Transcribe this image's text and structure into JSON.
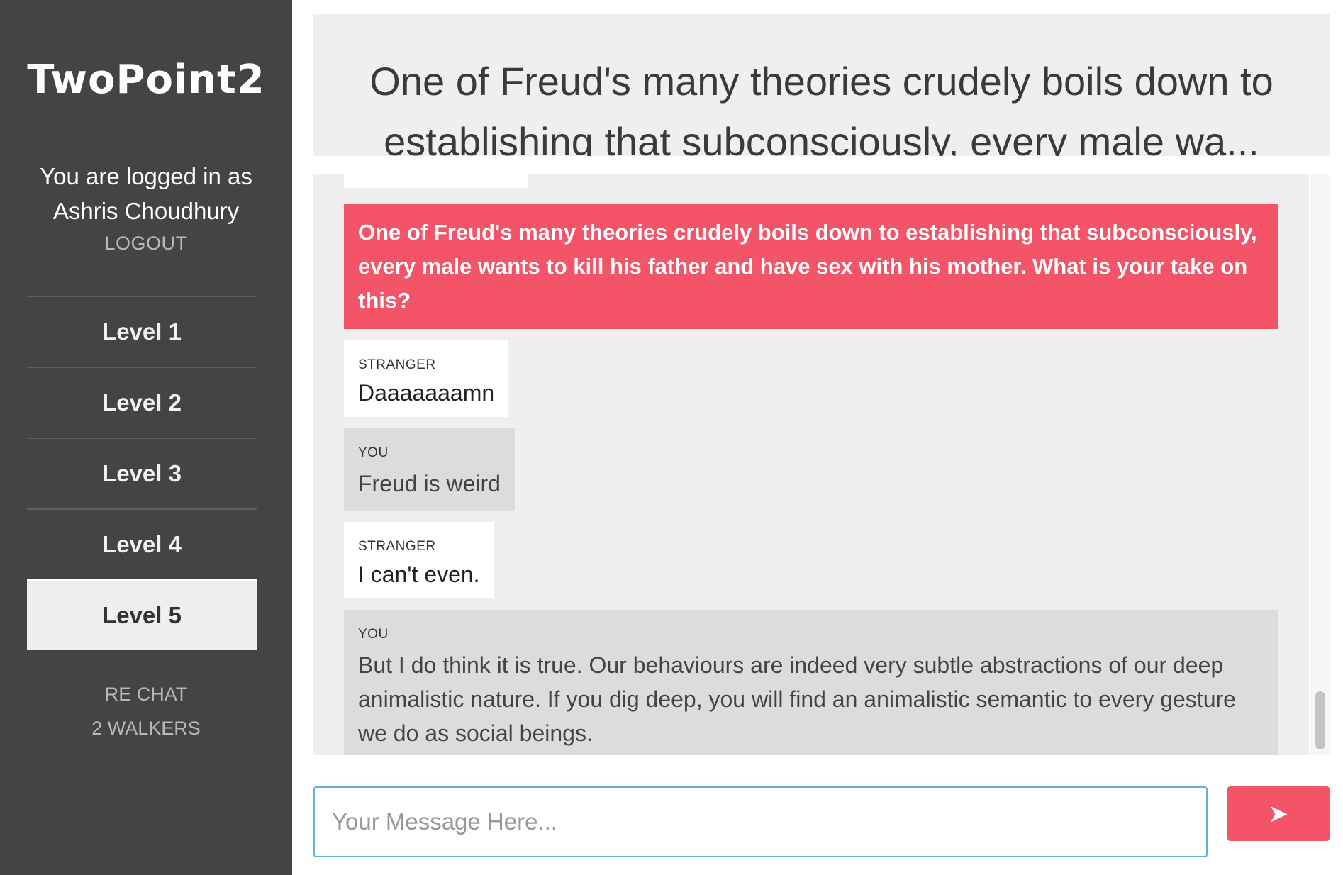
{
  "sidebar": {
    "app_title": "TwoPoint2",
    "logged_in_prefix": "You are logged in as",
    "user_name": "Ashris Choudhury",
    "logout_label": "LOGOUT",
    "levels": [
      {
        "label": "Level 1",
        "active": false
      },
      {
        "label": "Level 2",
        "active": false
      },
      {
        "label": "Level 3",
        "active": false
      },
      {
        "label": "Level 4",
        "active": false
      },
      {
        "label": "Level 5",
        "active": true
      }
    ],
    "rechat_label": "RE CHAT",
    "walkers_label": "2 WALKERS"
  },
  "topic": {
    "line1": "One of Freud's many theories crudely boils down to",
    "line2": "establishing that subconsciously, every male wa..."
  },
  "chat": {
    "topic_message": "One of Freud's many theories crudely boils down to establishing that subconsciously, every male wants to kill his father and have sex with his mother. What is your take on this?",
    "messages": [
      {
        "sender": "STRANGER",
        "text": "Daaaaaaamn"
      },
      {
        "sender": "YOU",
        "text": "Freud is weird"
      },
      {
        "sender": "STRANGER",
        "text": "I can't even."
      },
      {
        "sender": "YOU",
        "text": "But I do think it is true. Our behaviours are indeed very subtle abstractions of our deep animalistic nature. If you dig deep, you will find an animalistic semantic to every gesture we do as social beings."
      }
    ]
  },
  "composer": {
    "placeholder": "Your Message Here...",
    "value": "",
    "send_icon": "send-arrow-icon",
    "send_glyph": "➤"
  },
  "colors": {
    "sidebar_bg": "#444444",
    "accent": "#f35468",
    "panel_bg": "#efefef",
    "you_bubble": "#dcdcdc",
    "input_border": "#6aaede"
  }
}
